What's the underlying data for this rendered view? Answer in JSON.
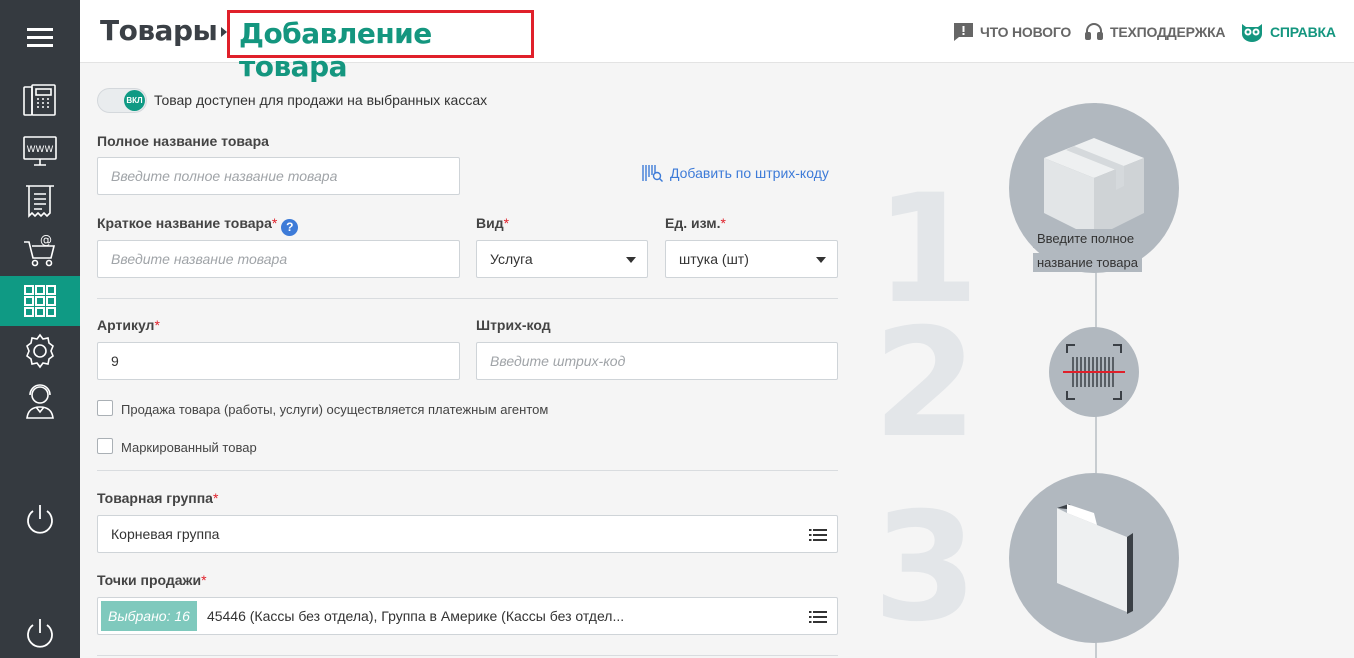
{
  "header": {
    "breadcrumb_root": "Товары",
    "breadcrumb_current": "Добавление товара",
    "links": {
      "whats_new": "ЧТО НОВОГО",
      "support": "ТЕХПОДДЕРЖКА",
      "help": "СПРАВКА"
    }
  },
  "sidebar": {
    "items": [
      "menu-icon",
      "cash-register-icon",
      "www-icon",
      "receipt-icon",
      "online-cart-icon",
      "products-grid-icon",
      "settings-gear-icon",
      "support-agent-icon",
      "power-icon",
      "logout-power-icon"
    ],
    "active_index": 5,
    "accent": "#0f9a84"
  },
  "form": {
    "toggle": {
      "knob_label": "ВКЛ",
      "label": "Товар доступен для продажи на выбранных кассах",
      "on": true
    },
    "full_name": {
      "label": "Полное название товара",
      "placeholder": "Введите полное название товара"
    },
    "barcode_link": "Добавить по штрих-коду",
    "short_name": {
      "label": "Краткое название товара",
      "placeholder": "Введите название товара",
      "help": "?"
    },
    "kind": {
      "label": "Вид",
      "value": "Услуга"
    },
    "unit": {
      "label": "Ед. изм.",
      "value": "штука (шт)"
    },
    "article": {
      "label": "Артикул",
      "value": "9"
    },
    "barcode": {
      "label": "Штрих-код",
      "placeholder": "Введите штрих-код"
    },
    "cb_agent": "Продажа товара (работы, услуги) осуществляется платежным агентом",
    "cb_marked": "Маркированный товар",
    "group": {
      "label": "Товарная группа",
      "value": "Корневая группа"
    },
    "points": {
      "label": "Точки продажи",
      "badge": "Выбрано: 16",
      "value": "45446 (Кассы без отдела), Группа в Америке (Кассы без отдел..."
    },
    "required_mark": "*"
  },
  "illustration": {
    "steps": [
      "1",
      "2",
      "3"
    ],
    "tip_line1": "Введите полное",
    "tip_line2": "название товара"
  }
}
